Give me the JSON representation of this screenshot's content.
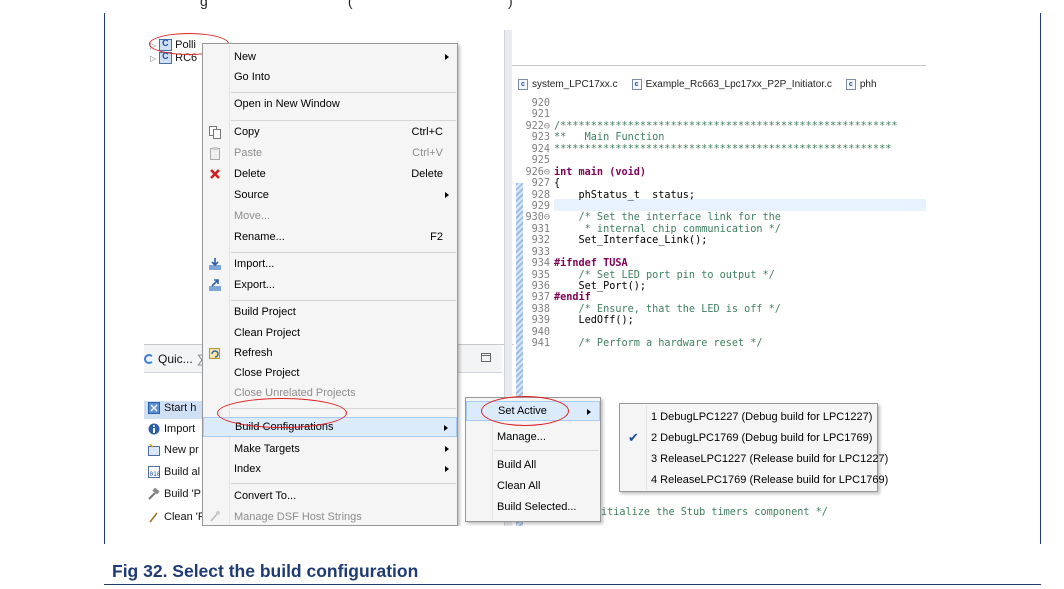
{
  "top_line": "g                                    (                                        )",
  "project_tree": [
    {
      "label": "Polli"
    },
    {
      "label": "RC6"
    }
  ],
  "bottom_view": {
    "quick_tab": "Quic...",
    "quick_tab_suffix": "∑",
    "welcome_items": [
      {
        "label": "Start h",
        "icon": "start-icon"
      },
      {
        "label": "Import",
        "icon": "import-icon"
      },
      {
        "label": "New pr",
        "icon": "new-project-icon"
      },
      {
        "label": "Build al",
        "icon": "build-all-icon"
      },
      {
        "label": "Build 'P",
        "icon": "hammer-icon"
      },
      {
        "label": "Clean 'P",
        "icon": "clean-icon"
      }
    ]
  },
  "editor_tabs": [
    {
      "label": "system_LPC17xx.c"
    },
    {
      "label": "Example_Rc663_Lpc17xx_P2P_Initiator.c"
    },
    {
      "label": "phh"
    }
  ],
  "code_lines": [
    {
      "n": "920",
      "text": "",
      "kind": "plain"
    },
    {
      "n": "921",
      "text": "",
      "kind": "plain"
    },
    {
      "n": "922⊖",
      "text": "/*******************************************************",
      "kind": "comment"
    },
    {
      "n": "923",
      "text": "**   Main Function",
      "kind": "comment"
    },
    {
      "n": "924",
      "text": "*******************************************************",
      "kind": "comment"
    },
    {
      "n": "925",
      "text": "",
      "kind": "plain"
    },
    {
      "n": "926⊖",
      "text": "int main (void)",
      "kind": "keyword"
    },
    {
      "n": "927",
      "text": "{",
      "kind": "plain"
    },
    {
      "n": "928",
      "text": "    phStatus_t  status;",
      "kind": "plain"
    },
    {
      "n": "929",
      "text": "",
      "kind": "plain"
    },
    {
      "n": "930⊖",
      "text": "    /* Set the interface link for the",
      "kind": "comment"
    },
    {
      "n": "931",
      "text": "     * internal chip communication */",
      "kind": "comment"
    },
    {
      "n": "932",
      "text": "    Set_Interface_Link();",
      "kind": "plain"
    },
    {
      "n": "933",
      "text": "",
      "kind": "plain"
    },
    {
      "n": "934",
      "text": "#ifndef TUSA",
      "kind": "keyword"
    },
    {
      "n": "935",
      "text": "    /* Set LED port pin to output */",
      "kind": "comment"
    },
    {
      "n": "936",
      "text": "    Set_Port();",
      "kind": "plain"
    },
    {
      "n": "937",
      "text": "#endif",
      "kind": "keyword"
    },
    {
      "n": "938",
      "text": "    /* Ensure, that the LED is off */",
      "kind": "comment"
    },
    {
      "n": "939",
      "text": "    LedOff();",
      "kind": "plain"
    },
    {
      "n": "940",
      "text": "",
      "kind": "plain"
    },
    {
      "n": "941",
      "text": "    /* Perform a hardware reset */",
      "kind": "comment"
    }
  ],
  "code_tail": "itialize the Stub timers component */",
  "context_menu": {
    "items": [
      {
        "label": "New",
        "submenu": true
      },
      {
        "label": "Go Into"
      },
      {
        "label": "Open in New Window"
      },
      {
        "label": "Copy",
        "shortcut": "Ctrl+C",
        "icon": "copy-icon"
      },
      {
        "label": "Paste",
        "shortcut": "Ctrl+V",
        "icon": "paste-icon",
        "disabled": true
      },
      {
        "label": "Delete",
        "shortcut": "Delete",
        "icon": "delete-icon"
      },
      {
        "label": "Source",
        "submenu": true
      },
      {
        "label": "Move...",
        "disabled": true
      },
      {
        "label": "Rename...",
        "shortcut": "F2"
      },
      {
        "label": "Import...",
        "icon": "import-icon"
      },
      {
        "label": "Export...",
        "icon": "export-icon"
      },
      {
        "label": "Build Project"
      },
      {
        "label": "Clean Project"
      },
      {
        "label": "Refresh",
        "icon": "refresh-icon"
      },
      {
        "label": "Close Project"
      },
      {
        "label": "Close Unrelated Projects",
        "disabled": true
      },
      {
        "label": "Build Configurations",
        "submenu": true,
        "highlighted": true
      },
      {
        "label": "Make Targets",
        "submenu": true
      },
      {
        "label": "Index",
        "submenu": true
      },
      {
        "label": "Convert To..."
      },
      {
        "label": "Manage DSF Host Strings",
        "disabled": true,
        "icon": "dsf-icon"
      }
    ]
  },
  "build_config_menu": {
    "items": [
      {
        "label": "Set Active",
        "submenu": true,
        "highlighted": true
      },
      {
        "label": "Manage..."
      },
      {
        "label": "Build All"
      },
      {
        "label": "Clean All"
      },
      {
        "label": "Build Selected..."
      }
    ]
  },
  "set_active_menu": {
    "items": [
      {
        "label": "1 DebugLPC1227 (Debug build for LPC1227)",
        "checked": false
      },
      {
        "label": "2 DebugLPC1769 (Debug build for LPC1769)",
        "checked": true
      },
      {
        "label": "3 ReleaseLPC1227 (Release build for LPC1227)",
        "checked": false
      },
      {
        "label": "4 ReleaseLPC1769 (Release build for LPC1769)",
        "checked": false
      }
    ],
    "check_mark": "✔"
  },
  "caption": "Fig 32.   Select the build configuration",
  "colors": {
    "annotation": "#e02020",
    "caption": "#1f3b73",
    "menu_highlight": "#dcebfc"
  }
}
